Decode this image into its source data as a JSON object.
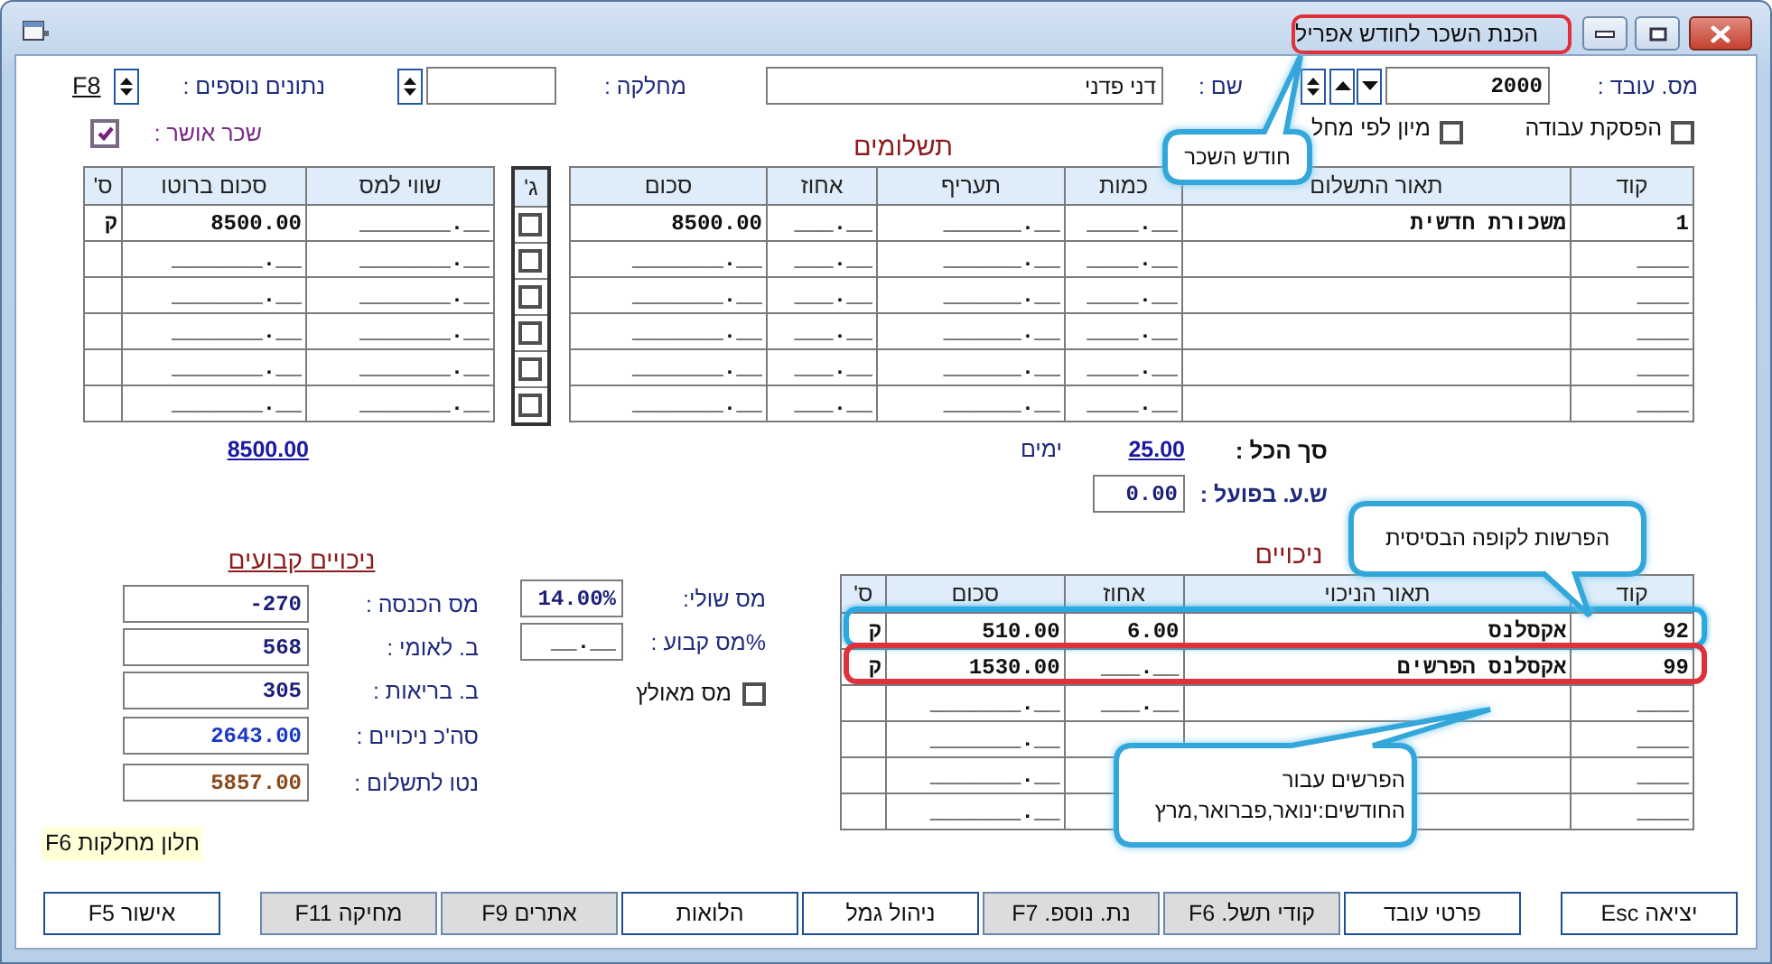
{
  "window": {
    "title": "הכנת השכר לחודש אפריל",
    "color": "#e0303a"
  },
  "header": {
    "employee_number": {
      "label": "מס. עובד :",
      "value": "2000"
    },
    "name": {
      "label": "שם :",
      "value": "דני פדני"
    },
    "department": {
      "label": "מחלקה :"
    },
    "extra_data": {
      "label": "נתונים נוספים :",
      "key": "F8"
    }
  },
  "options": [
    {
      "label": "הפסקת עבודה",
      "checked": false
    },
    {
      "label": "מיון לפי מחל",
      "checked": false
    }
  ],
  "salary_approved": {
    "label": "שכר אושר :",
    "checked": true
  },
  "payments": {
    "title": "תשלומים",
    "columns": [
      "קוד",
      "תאור התשלום",
      "כמות",
      "תעריף",
      "אחוז",
      "סכום"
    ],
    "rows": [
      {
        "code": "1",
        "description": "משכורת חדשית",
        "quantity": "____.__",
        "rate": "______.__",
        "percent": "___.__",
        "amount": "8500.00"
      },
      {
        "code": "____",
        "quantity": "____.__",
        "rate": "______.__",
        "percent": "___.__",
        "amount": "_______.__"
      },
      {
        "code": "____",
        "quantity": "____.__",
        "rate": "______.__",
        "percent": "___.__",
        "amount": "_______.__"
      },
      {
        "code": "____",
        "quantity": "____.__",
        "rate": "______.__",
        "percent": "___.__",
        "amount": "_______.__"
      },
      {
        "code": "____",
        "quantity": "____.__",
        "rate": "______.__",
        "percent": "___.__",
        "amount": "_______.__"
      },
      {
        "code": "____",
        "quantity": "____.__",
        "rate": "______.__",
        "percent": "___.__",
        "amount": "_______.__"
      }
    ]
  },
  "flags": {
    "column": "ג'",
    "rows": [
      {
        "checked": false
      },
      {
        "checked": false
      },
      {
        "checked": false
      },
      {
        "checked": false
      },
      {
        "checked": false
      },
      {
        "checked": false
      }
    ]
  },
  "gross": {
    "columns": [
      "שווי למס",
      "סכום ברוטו",
      "ס'"
    ],
    "rows": [
      {
        "taxable_value": "_______.__",
        "gross_amount": "8500.00",
        "type": "ק"
      },
      {
        "taxable_value": "_______.__",
        "gross_amount": "_______.__"
      },
      {
        "taxable_value": "_______.__",
        "gross_amount": "_______.__"
      },
      {
        "taxable_value": "_______.__",
        "gross_amount": "_______.__"
      },
      {
        "taxable_value": "_______.__",
        "gross_amount": "_______.__"
      },
      {
        "taxable_value": "_______.__",
        "gross_amount": "_______.__"
      }
    ],
    "total": "8500.00"
  },
  "summary": {
    "total_label": "סך הכל :",
    "days_value": "25.00",
    "days_label": "ימים",
    "actual_hours_label": "ש.ע. בפועל :",
    "actual_hours_value": "0.00"
  },
  "deductions": {
    "title": "ניכויים",
    "columns": [
      "קוד",
      "תאור הניכוי",
      "אחוז",
      "סכום",
      "ס'"
    ],
    "rows": [
      {
        "code": "92",
        "description": "אקסלנס",
        "percent": "6.00",
        "amount": "510.00",
        "type": "ק",
        "color": "#2aa9e0"
      },
      {
        "code": "99",
        "description": "אקסלנס הפרשים",
        "percent": "___.__",
        "amount": "1530.00",
        "type": "ק",
        "color": "#e0303a"
      },
      {
        "code": "____",
        "percent": "___.__",
        "amount": "_______.__"
      },
      {
        "code": "____",
        "amount": "_______.__"
      },
      {
        "code": "____",
        "amount": "_______.__"
      },
      {
        "code": "____",
        "amount": "_______.__"
      }
    ]
  },
  "tax": {
    "marginal": {
      "label": "מס שולי:",
      "value": "14.00%"
    },
    "fixed": {
      "label": "%מס קבוע :",
      "value": "__.__"
    },
    "forced": {
      "label": "מס מאולץ",
      "checked": false
    }
  },
  "fixed_deductions": {
    "title": "ניכויים קבועים",
    "fields": [
      {
        "label": "מס הכנסה :",
        "value": "-270",
        "color": "#1c1f7a"
      },
      {
        "label": "ב. לאומי :",
        "value": "568",
        "color": "#1c1f7a"
      },
      {
        "label": "ב. בריאות :",
        "value": "305",
        "color": "#1c1f7a"
      },
      {
        "label": "סה'כ ניכויים :",
        "value": "2643.00",
        "color": "#1a3ac4"
      },
      {
        "label": "נטו לתשלום :",
        "value": "5857.00",
        "color": "#8a4a1c"
      }
    ]
  },
  "hint": "F6 חלון מחלקות",
  "buttons": [
    {
      "label": "יציאה Esc",
      "shaded": false
    },
    {
      "label": "פרטי עובד",
      "shaded": false
    },
    {
      "label": "קודי תשל. F6",
      "shaded": true
    },
    {
      "label": "נת. נוספ. F7",
      "shaded": true
    },
    {
      "label": "ניהול גמל",
      "shaded": false
    },
    {
      "label": "הלואות",
      "shaded": false
    },
    {
      "label": "אתרים F9",
      "shaded": true
    },
    {
      "label": "מחיקה F11",
      "shaded": true
    },
    {
      "label": "אישור F5",
      "shaded": false
    }
  ],
  "callouts": [
    {
      "text": "חודש השכר"
    },
    {
      "text": "הפרשות לקופה הבסיסית"
    },
    {
      "text": "הפרשים עבור החודשים:ינואר,פברואר,מרץ"
    }
  ]
}
